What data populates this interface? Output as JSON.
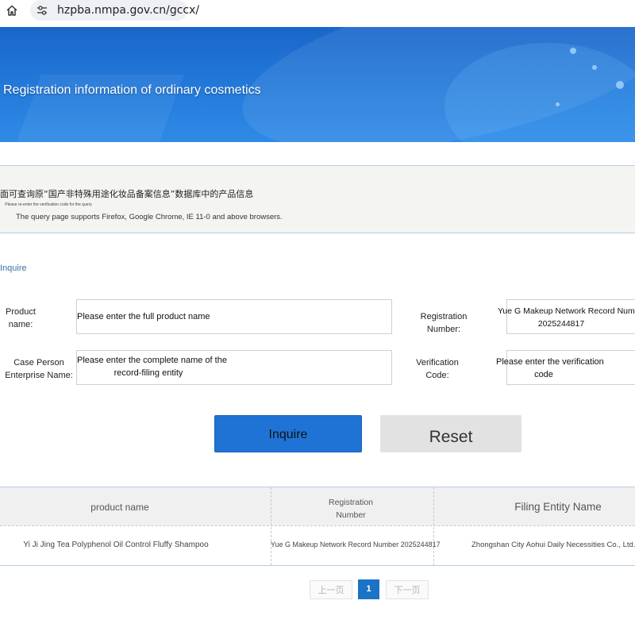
{
  "browser": {
    "url": "hzpba.nmpa.gov.cn/gccx/"
  },
  "banner": {
    "title": "Registration information of ordinary cosmetics"
  },
  "notice": {
    "cn_text": "面可查询原“国产非特殊用途化妆品备案信息”数据库中的产品信息",
    "small_text": "Please re-enter the verification code for the query",
    "browser_support": "The query page supports Firefox, Google Chrome, IE 11-0 and above browsers."
  },
  "section": {
    "inquire_label": "Inquire"
  },
  "form": {
    "product_name": {
      "label": "Product name:",
      "placeholder": "Please enter the full product name"
    },
    "registration_number": {
      "label": "Registration Number:",
      "value_line1": "Yue G Makeup Network Record Number",
      "value_line2": "2025244817"
    },
    "enterprise_name": {
      "label": "Case Person Enterprise Name:",
      "placeholder_line1": "Please enter the complete name of the",
      "placeholder_line2": "record-filing entity"
    },
    "verification_code": {
      "label": "Verification Code:",
      "placeholder_line1": "Please enter the verification",
      "placeholder_line2": "code"
    }
  },
  "buttons": {
    "inquire": "Inquire",
    "reset": "Reset"
  },
  "table": {
    "headers": {
      "product_name": "product name",
      "registration_number": "Registration Number",
      "filing_entity": "Filing Entity Name"
    },
    "rows": [
      {
        "product_name": "Yi Ji Jing Tea Polyphenol Oil Control Fluffy Shampoo",
        "registration_number": "Yue G Makeup Network Record Number 2025244817",
        "filing_entity": "Zhongshan City Aohui Daily Necessities Co., Ltd."
      }
    ]
  },
  "pagination": {
    "prev": "上一页",
    "current": "1",
    "next": "下一页"
  },
  "colors": {
    "banner_blue": "#2177d8",
    "inquire_button": "#1f73d5",
    "reset_button": "#e2e2e2",
    "page_current": "#1a73c4",
    "border_blue": "#b9cde6"
  },
  "icons": [
    "home-icon",
    "site-settings-icon"
  ]
}
